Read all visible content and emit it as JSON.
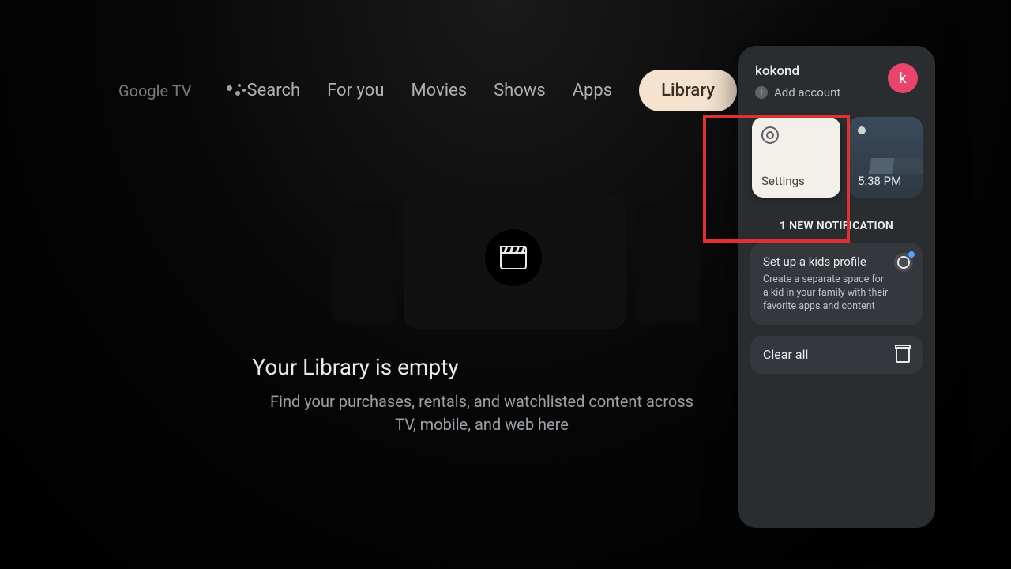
{
  "brand": "Google TV",
  "nav": {
    "search": "Search",
    "foryou": "For you",
    "movies": "Movies",
    "shows": "Shows",
    "apps": "Apps",
    "library": "Library"
  },
  "library": {
    "title": "Your Library is empty",
    "subtitle": "Find your purchases, rentals, and watchlisted content across TV, mobile, and web here"
  },
  "panel": {
    "account_name": "kokond",
    "add_account": "Add account",
    "avatar_initial": "k",
    "settings_label": "Settings",
    "time": "5:38 PM",
    "notification_header": "1 NEW NOTIFICATION",
    "kids": {
      "title": "Set up a kids profile",
      "body": "Create a separate space for a kid in your family with their favorite apps and content"
    },
    "clear_all": "Clear all"
  }
}
